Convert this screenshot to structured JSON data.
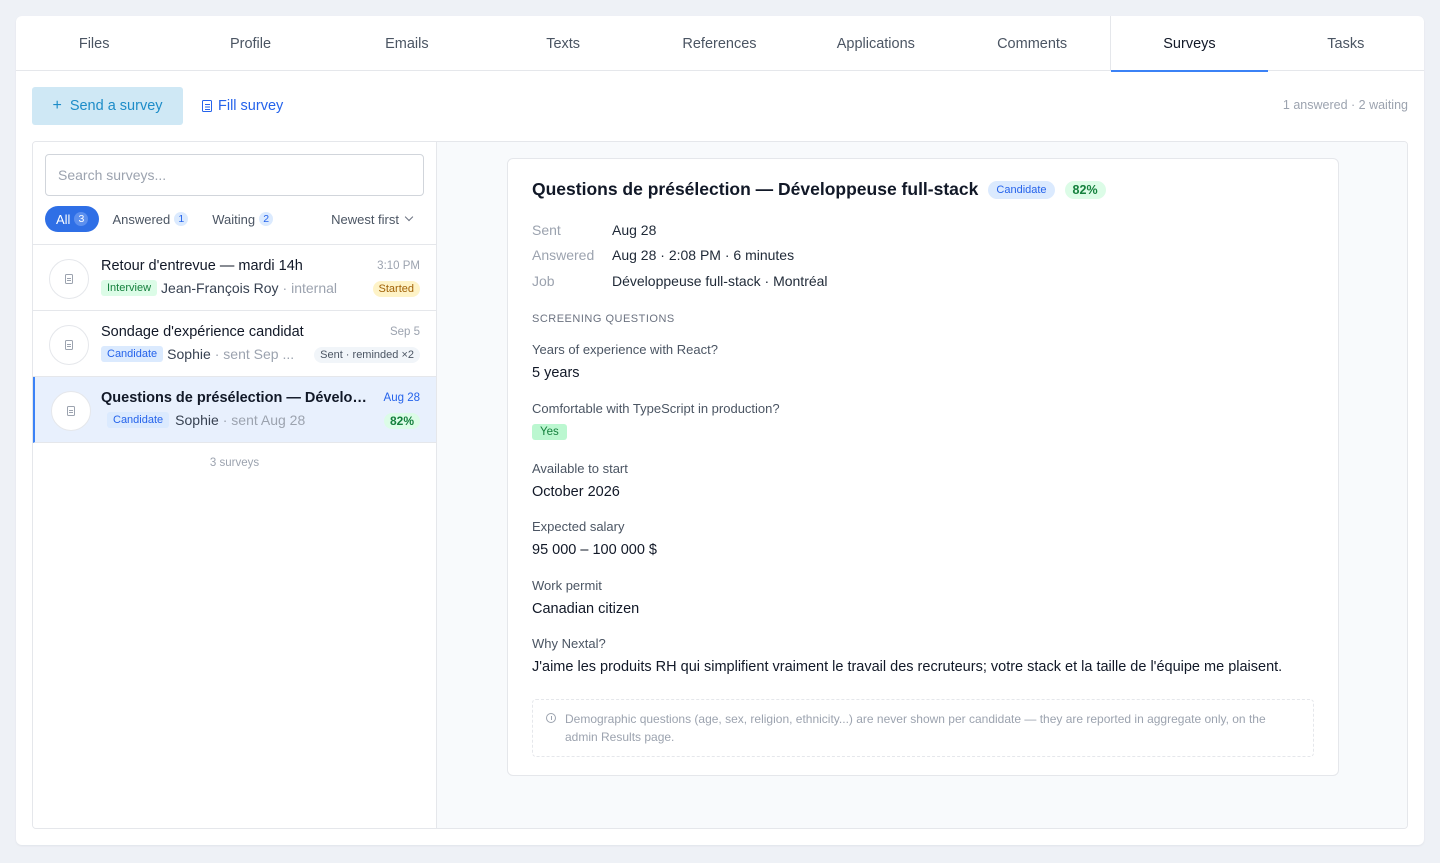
{
  "tabs": [
    "Files",
    "Profile",
    "Emails",
    "Texts",
    "References",
    "Applications",
    "Comments",
    "Surveys",
    "Tasks"
  ],
  "toolbar": {
    "send_label": "Send a survey",
    "fill_label": "Fill survey",
    "summary": "1 answered · 2 waiting"
  },
  "search": {
    "placeholder": "Search surveys..."
  },
  "filters": {
    "all": {
      "label": "All",
      "count": "3"
    },
    "answered": {
      "label": "Answered",
      "count": "1"
    },
    "waiting": {
      "label": "Waiting",
      "count": "2"
    },
    "sort": "Newest first"
  },
  "surveys": [
    {
      "title": "Retour d'entrevue — mardi 14h",
      "time": "3:10 PM",
      "tag": "Interview",
      "person": "Jean-François Roy",
      "detail": " · internal",
      "status": "Started"
    },
    {
      "title": "Sondage d'expérience candidat",
      "time": "Sep 5",
      "tag": "Candidate",
      "person": "Sophie",
      "detail": " · sent Sep ...",
      "status": "Sent · reminded ×2"
    },
    {
      "title": "Questions de présélection — Dévelop...",
      "time": "Aug 28",
      "tag": "Candidate",
      "person": "Sophie",
      "detail": " · sent Aug 28",
      "status": "82%"
    }
  ],
  "list_count": "3 surveys",
  "detail": {
    "title": "Questions de présélection — Développeuse full-stack",
    "tag": "Candidate",
    "score": "82%",
    "meta": [
      {
        "label": "Sent",
        "value": "Aug 28"
      },
      {
        "label": "Answered",
        "value": "Aug 28 · 2:08 PM · 6 minutes"
      },
      {
        "label": "Job",
        "value": "Développeuse full-stack · Montréal"
      }
    ],
    "section": "SCREENING QUESTIONS",
    "questions": [
      {
        "q": "Years of experience with React?",
        "a": "5 years"
      },
      {
        "q": "Comfortable with TypeScript in production?",
        "a": "Yes"
      },
      {
        "q": "Available to start",
        "a": "October 2026"
      },
      {
        "q": "Expected salary",
        "a": "95 000 – 100 000 $"
      },
      {
        "q": "Work permit",
        "a": "Canadian citizen"
      },
      {
        "q": "Why Nextal?",
        "a": "J'aime les produits RH qui simplifient vraiment le travail des recruteurs; votre stack et la taille de l'équipe me plaisent."
      }
    ],
    "note": "Demographic questions (age, sex, religion, ethnicity...) are never shown per candidate — they are reported in aggregate only, on the admin Results page."
  },
  "colors": {
    "accent": "#3b82f6",
    "send_bg": "#cfe8f5",
    "success": "#15803d"
  }
}
